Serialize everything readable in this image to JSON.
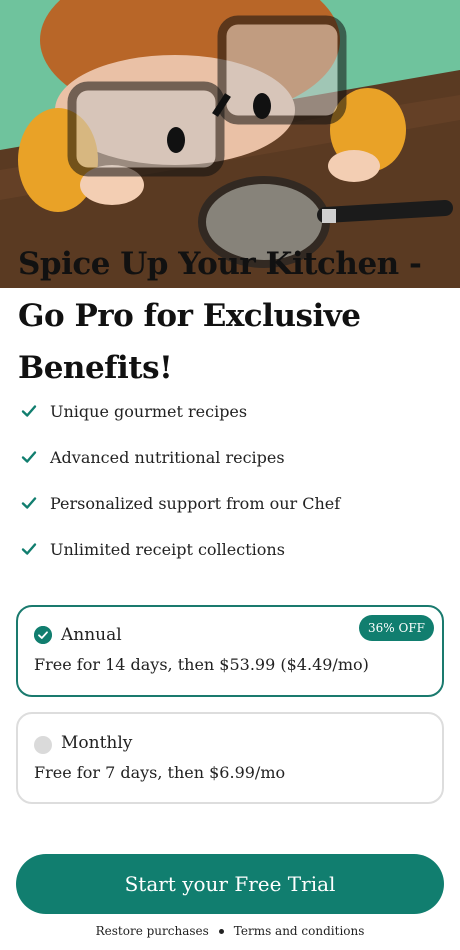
{
  "hero": {
    "illustration_icon": "child-with-glasses-magnifier-illustration",
    "headline": "Spice Up Your Kitchen - Go Pro for Exclusive Benefits!"
  },
  "benefits": [
    {
      "icon": "check-icon",
      "label": "Unique gourmet recipes"
    },
    {
      "icon": "check-icon",
      "label": "Advanced nutritional recipes"
    },
    {
      "icon": "check-icon",
      "label": "Personalized support from our Chef"
    },
    {
      "icon": "check-icon",
      "label": "Unlimited receipt collections"
    }
  ],
  "plans": {
    "annual": {
      "name": "Annual",
      "description": "Free for 14 days, then $53.99 ($4.49/mo)",
      "badge": "36% OFF",
      "selected": true
    },
    "monthly": {
      "name": "Monthly",
      "description": "Free for 7 days, then $6.99/mo",
      "selected": false
    }
  },
  "cta": {
    "label": "Start your Free Trial"
  },
  "footer": {
    "restore_label": "Restore purchases",
    "terms_label": "Terms and conditions"
  },
  "colors": {
    "accent": "#117e6f",
    "background_green": "#6fc39d",
    "table_brown": "#5a3a22"
  }
}
